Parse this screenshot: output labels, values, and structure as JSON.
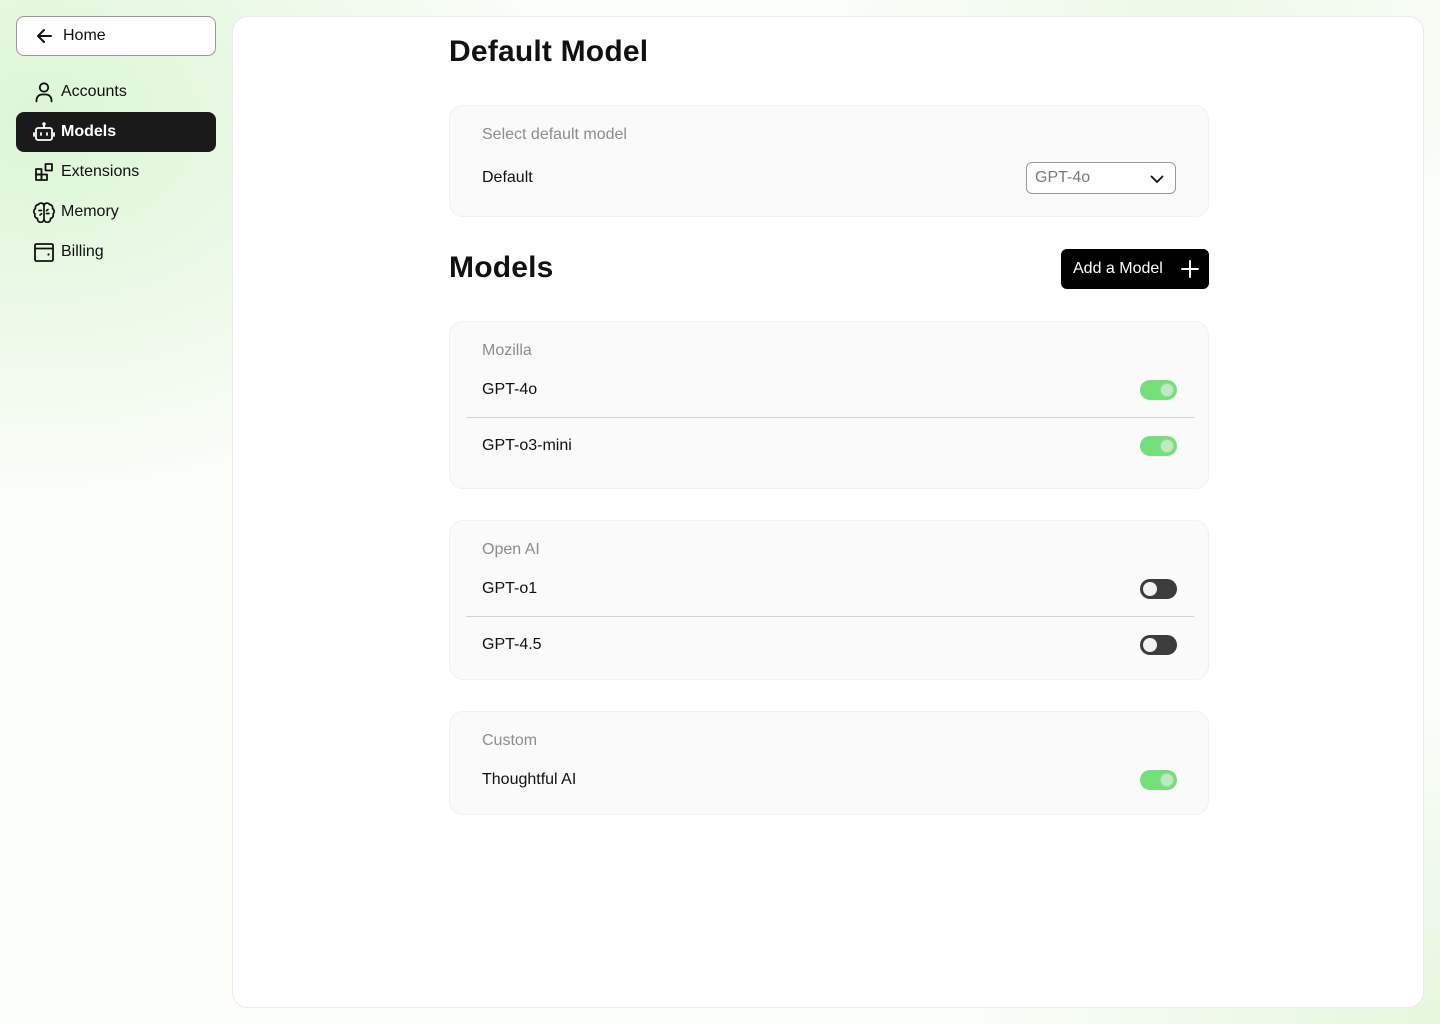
{
  "sidebar": {
    "home_label": "Home",
    "items": [
      {
        "label": "Accounts",
        "icon": "user-icon",
        "active": false
      },
      {
        "label": "Models",
        "icon": "bot-icon",
        "active": true
      },
      {
        "label": "Extensions",
        "icon": "blocks-icon",
        "active": false
      },
      {
        "label": "Memory",
        "icon": "brain-icon",
        "active": false
      },
      {
        "label": "Billing",
        "icon": "wallet-icon",
        "active": false
      }
    ]
  },
  "main": {
    "default_section": {
      "title": "Default Model",
      "card_label": "Select default model",
      "row_label": "Default",
      "selected_value": "GPT-4o"
    },
    "models_section": {
      "title": "Models",
      "add_button_label": "Add a Model",
      "groups": [
        {
          "provider": "Mozilla",
          "models": [
            {
              "name": "GPT-4o",
              "enabled": true
            },
            {
              "name": "GPT-o3-mini",
              "enabled": true
            }
          ]
        },
        {
          "provider": "Open AI",
          "models": [
            {
              "name": "GPT-o1",
              "enabled": false
            },
            {
              "name": "GPT-4.5",
              "enabled": false
            }
          ]
        },
        {
          "provider": "Custom",
          "models": [
            {
              "name": "Thoughtful AI",
              "enabled": true
            }
          ]
        }
      ]
    }
  },
  "colors": {
    "toggle_on": "#74e07c",
    "toggle_off": "#3c3c3c",
    "active_nav": "#1a1a1a"
  }
}
